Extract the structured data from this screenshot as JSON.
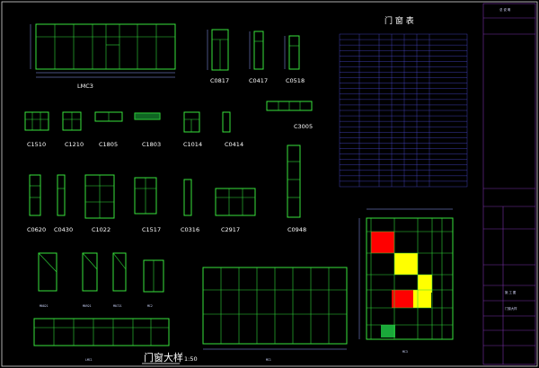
{
  "drawing": {
    "title_main": "门窗大样",
    "scale": "1:50",
    "labels": {
      "LMC3": "LMC3",
      "C0817": "C0817",
      "C0417": "C0417",
      "C0518": "C0518",
      "C1510": "C1510",
      "C1210": "C1210",
      "C1805": "C1805",
      "C1803": "C1803",
      "C1014": "C1014",
      "C0414": "C0414",
      "C3005": "C3005",
      "C0620": "C0620",
      "C0430": "C0430",
      "C1022": "C1022",
      "C1517": "C1517",
      "C0316": "C0316",
      "C2917": "C2917",
      "C0948": "C0948",
      "M0821": "M0821",
      "M0921": "M0921",
      "M0721": "M0721",
      "MC2": "MC2",
      "MC1": "MC1",
      "MC3": "MC3",
      "LMC1": "LMC1"
    }
  },
  "table": {
    "title": "门 窗 表"
  },
  "title_block": {
    "heading": "总 说 明",
    "stamp": "施 工 图",
    "drawing_no": "门窗大样"
  },
  "colors": {
    "background": "#000000",
    "frame_green": "#39e23b",
    "table_blue": "#4b4bd6",
    "title_block_purple": "#7a2ea8",
    "fill_red": "#ff0000",
    "fill_yellow": "#ffff00",
    "fill_green": "#1aa83a"
  }
}
